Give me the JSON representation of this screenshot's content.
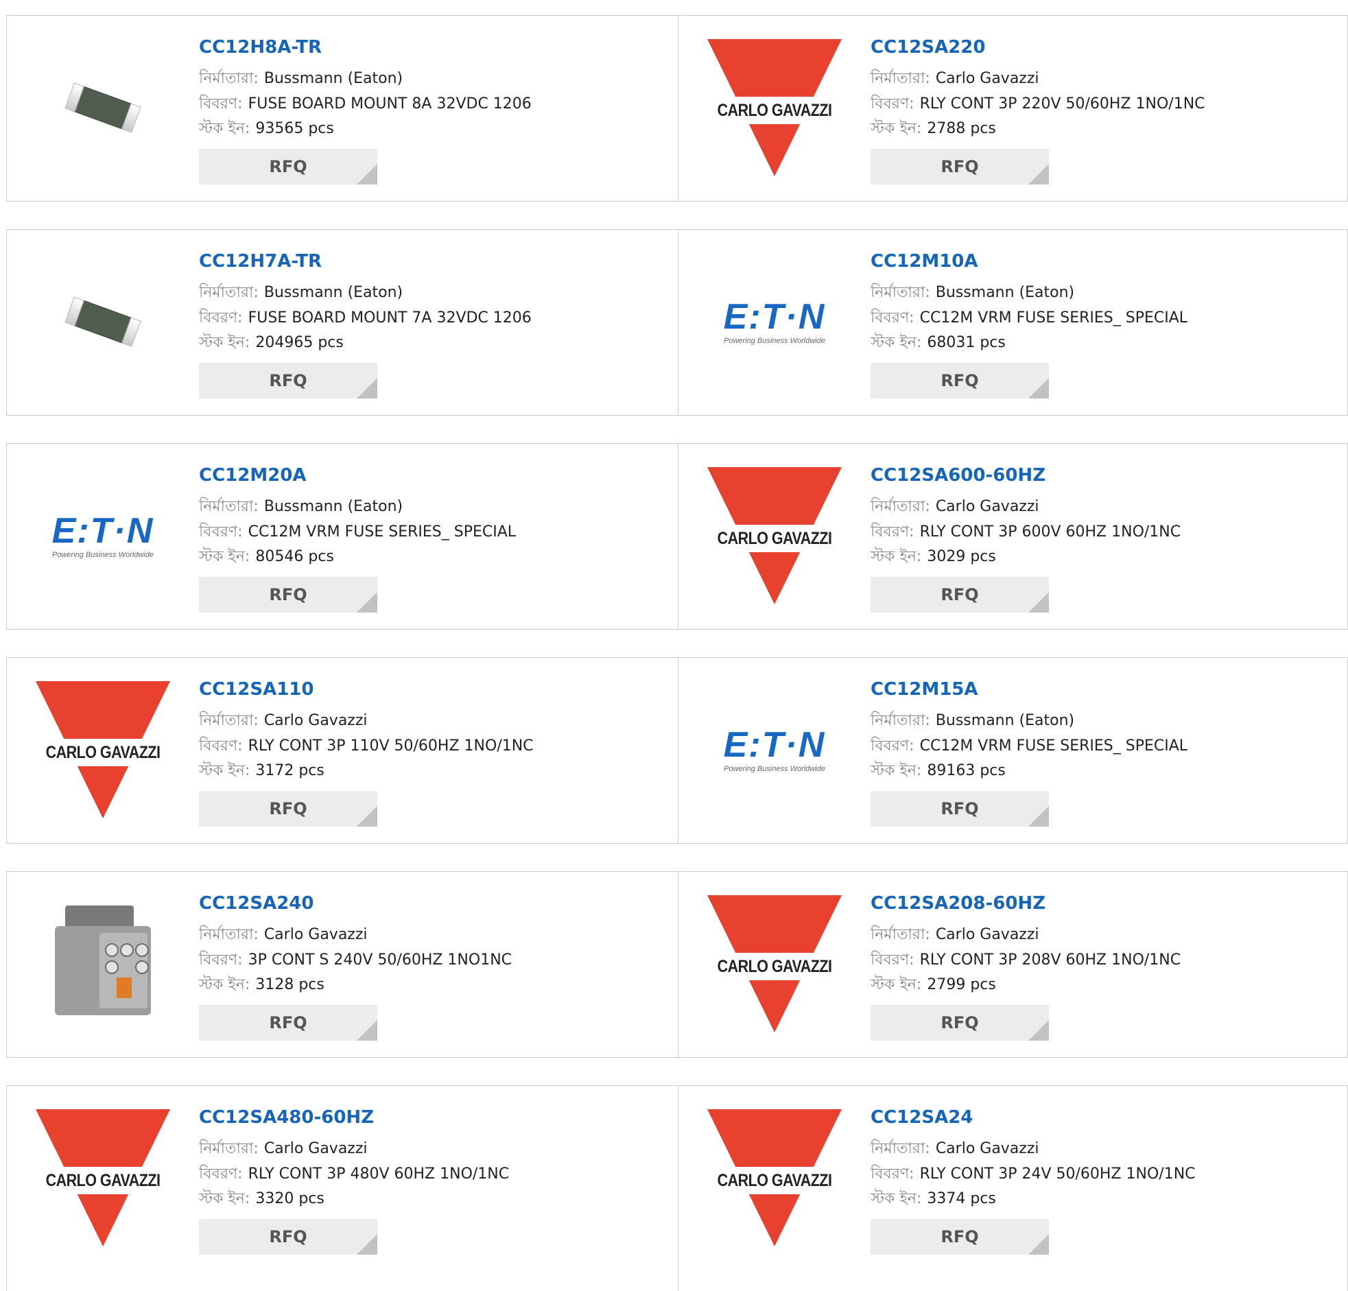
{
  "labels": {
    "manufacturer": "নির্মাতারা:",
    "description": "বিবরণ:",
    "stock": "স্টক ইন:"
  },
  "rfq_label": "RFQ",
  "logos": {
    "carlo_gavazzi": "CARLO GAVAZZI",
    "eaton_word": "E:T·N",
    "eaton_tagline": "Powering Business Worldwide"
  },
  "products": [
    {
      "part": "CC12H8A-TR",
      "manufacturer": "Bussmann (Eaton)",
      "description": "FUSE BOARD MOUNT 8A 32VDC 1206",
      "stock": "93565 pcs",
      "image": "smd-fuse-chip"
    },
    {
      "part": "CC12SA220",
      "manufacturer": "Carlo Gavazzi",
      "description": "RLY CONT 3P 220V 50/60HZ 1NO/1NC",
      "stock": "2788 pcs",
      "image": "carlo-gavazzi-logo"
    },
    {
      "part": "CC12H7A-TR",
      "manufacturer": "Bussmann (Eaton)",
      "description": "FUSE BOARD MOUNT 7A 32VDC 1206",
      "stock": "204965 pcs",
      "image": "smd-fuse-chip"
    },
    {
      "part": "CC12M10A",
      "manufacturer": "Bussmann (Eaton)",
      "description": "CC12M VRM FUSE SERIES_ SPECIAL",
      "stock": "68031 pcs",
      "image": "eaton-logo"
    },
    {
      "part": "CC12M20A",
      "manufacturer": "Bussmann (Eaton)",
      "description": "CC12M VRM FUSE SERIES_ SPECIAL",
      "stock": "80546 pcs",
      "image": "eaton-logo"
    },
    {
      "part": "CC12SA600-60HZ",
      "manufacturer": "Carlo Gavazzi",
      "description": "RLY CONT 3P 600V 60HZ 1NO/1NC",
      "stock": "3029 pcs",
      "image": "carlo-gavazzi-logo"
    },
    {
      "part": "CC12SA110",
      "manufacturer": "Carlo Gavazzi",
      "description": "RLY CONT 3P 110V 50/60HZ 1NO/1NC",
      "stock": "3172 pcs",
      "image": "carlo-gavazzi-logo"
    },
    {
      "part": "CC12M15A",
      "manufacturer": "Bussmann (Eaton)",
      "description": "CC12M VRM FUSE SERIES_ SPECIAL",
      "stock": "89163 pcs",
      "image": "eaton-logo"
    },
    {
      "part": "CC12SA240",
      "manufacturer": "Carlo Gavazzi",
      "description": "3P CONT S 240V 50/60HZ 1NO1NC",
      "stock": "3128 pcs",
      "image": "contactor-photo"
    },
    {
      "part": "CC12SA208-60HZ",
      "manufacturer": "Carlo Gavazzi",
      "description": "RLY CONT 3P 208V 60HZ 1NO/1NC",
      "stock": "2799 pcs",
      "image": "carlo-gavazzi-logo"
    },
    {
      "part": "CC12SA480-60HZ",
      "manufacturer": "Carlo Gavazzi",
      "description": "RLY CONT 3P 480V 60HZ 1NO/1NC",
      "stock": "3320 pcs",
      "image": "carlo-gavazzi-logo"
    },
    {
      "part": "CC12SA24",
      "manufacturer": "Carlo Gavazzi",
      "description": "RLY CONT 3P 24V 50/60HZ 1NO/1NC",
      "stock": "3374 pcs",
      "image": "carlo-gavazzi-logo"
    }
  ]
}
